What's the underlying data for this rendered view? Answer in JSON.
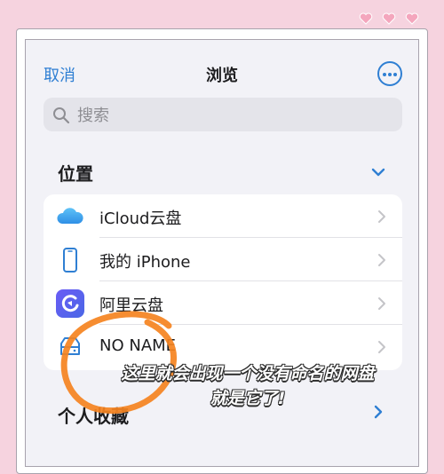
{
  "nav": {
    "cancel_label": "取消",
    "title": "浏览",
    "more_icon": "ellipsis-circle-icon"
  },
  "search": {
    "placeholder": "搜索",
    "value": ""
  },
  "locations": {
    "title": "位置",
    "items": [
      {
        "label": "iCloud云盘",
        "icon": "icloud-icon"
      },
      {
        "label": "我的 iPhone",
        "icon": "iphone-icon"
      },
      {
        "label": "阿里云盘",
        "icon": "aliyun-drive-icon"
      },
      {
        "label": "NO NAME",
        "icon": "external-drive-icon"
      }
    ]
  },
  "favorites": {
    "title": "个人收藏"
  },
  "annotation": {
    "line1": "这里就会出现一个没有命名的网盘",
    "line2": "就是它了!"
  },
  "colors": {
    "accent": "#2f7fd3",
    "annotation_circle": "#f5831f",
    "background": "#f6d3df"
  }
}
